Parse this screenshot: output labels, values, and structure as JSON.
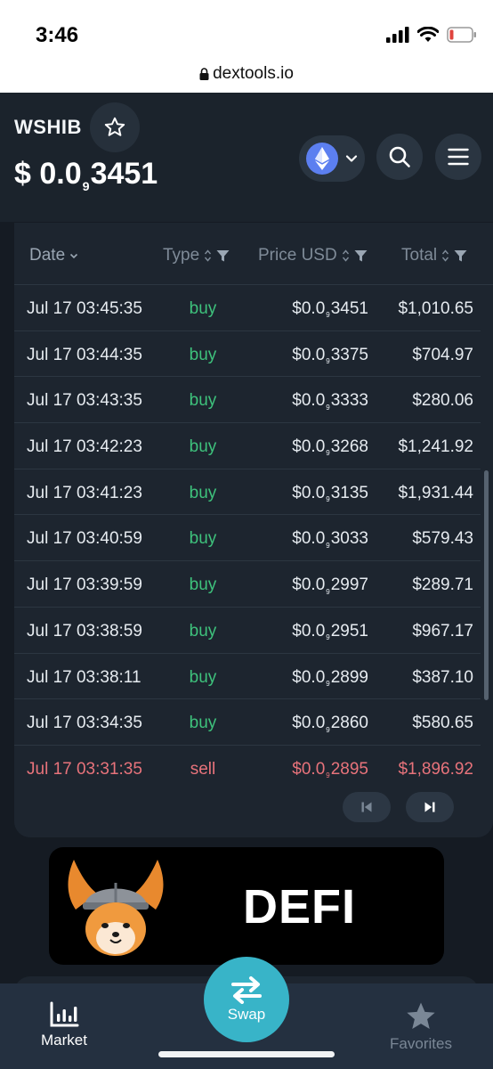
{
  "status_bar": {
    "time": "3:46"
  },
  "browser": {
    "url": "dextools.io"
  },
  "header": {
    "token_name": "WSHIB",
    "price_prefix": "$ 0.0",
    "price_zeros": "9",
    "price_digits": "3451"
  },
  "table": {
    "columns": {
      "date": "Date",
      "type": "Type",
      "price": "Price USD",
      "total": "Total"
    },
    "rows": [
      {
        "date": "Jul 17 03:45:35",
        "type": "buy",
        "price_prefix": "$0.0",
        "price_zeros": "9",
        "price_digits": "3451",
        "total": "$1,010.65"
      },
      {
        "date": "Jul 17 03:44:35",
        "type": "buy",
        "price_prefix": "$0.0",
        "price_zeros": "9",
        "price_digits": "3375",
        "total": "$704.97"
      },
      {
        "date": "Jul 17 03:43:35",
        "type": "buy",
        "price_prefix": "$0.0",
        "price_zeros": "9",
        "price_digits": "3333",
        "total": "$280.06"
      },
      {
        "date": "Jul 17 03:42:23",
        "type": "buy",
        "price_prefix": "$0.0",
        "price_zeros": "9",
        "price_digits": "3268",
        "total": "$1,241.92"
      },
      {
        "date": "Jul 17 03:41:23",
        "type": "buy",
        "price_prefix": "$0.0",
        "price_zeros": "9",
        "price_digits": "3135",
        "total": "$1,931.44"
      },
      {
        "date": "Jul 17 03:40:59",
        "type": "buy",
        "price_prefix": "$0.0",
        "price_zeros": "9",
        "price_digits": "3033",
        "total": "$579.43"
      },
      {
        "date": "Jul 17 03:39:59",
        "type": "buy",
        "price_prefix": "$0.0",
        "price_zeros": "9",
        "price_digits": "2997",
        "total": "$289.71"
      },
      {
        "date": "Jul 17 03:38:59",
        "type": "buy",
        "price_prefix": "$0.0",
        "price_zeros": "9",
        "price_digits": "2951",
        "total": "$967.17"
      },
      {
        "date": "Jul 17 03:38:11",
        "type": "buy",
        "price_prefix": "$0.0",
        "price_zeros": "9",
        "price_digits": "2899",
        "total": "$387.10"
      },
      {
        "date": "Jul 17 03:34:35",
        "type": "buy",
        "price_prefix": "$0.0",
        "price_zeros": "9",
        "price_digits": "2860",
        "total": "$580.65"
      },
      {
        "date": "Jul 17 03:31:35",
        "type": "sell",
        "price_prefix": "$0.0",
        "price_zeros": "9",
        "price_digits": "2895",
        "total": "$1,896.92"
      }
    ]
  },
  "ad": {
    "text": "DEFI"
  },
  "nav": {
    "market": "Market",
    "swap": "Swap",
    "favorites": "Favorites"
  },
  "colors": {
    "buy": "#3ec27c",
    "sell": "#e8737b",
    "accent": "#38b4c8",
    "background": "#151b23"
  },
  "icons": [
    "signal-icon",
    "wifi-icon",
    "battery-icon",
    "lock-icon",
    "star-icon",
    "ethereum-icon",
    "chevron-down-icon",
    "search-icon",
    "menu-icon",
    "filter-icon",
    "sort-icon",
    "first-page-icon",
    "last-page-icon",
    "swap-icon",
    "chart-icon",
    "favorites-star-icon"
  ]
}
